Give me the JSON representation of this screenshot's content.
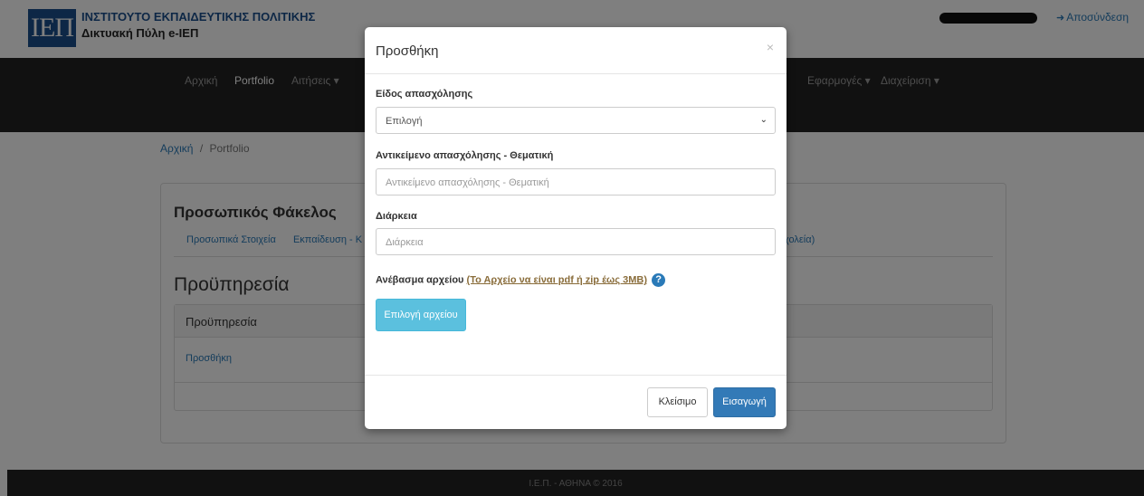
{
  "header": {
    "logo_text": "ΙΕΠ",
    "org_name": "ΙΝΣΤΙΤΟΥΤΟ ΕΚΠΑΙΔΕΥΤΙΚΗΣ ΠΟΛΙΤΙΚΗΣ",
    "portal_name": "Δικτυακή Πύλη e-ΙΕΠ",
    "logout_label": "Αποσύνδεση"
  },
  "nav": {
    "items": [
      "Αρχική",
      "Portfolio",
      "Αιτήσεις ▾",
      "Εφαρμογές ▾",
      "Διαχείριση ▾"
    ]
  },
  "breadcrumb": {
    "home": "Αρχική",
    "separator": "/",
    "current": "Portfolio"
  },
  "panel": {
    "title": "Προσωπικός Φάκελος",
    "tabs": [
      "Προσωπικά Στοιχεία",
      "Εκπαίδευση - Κ"
    ],
    "tab_right": "χολεία)",
    "section_title": "Προϋπηρεσία",
    "table_header": "Προϋπηρεσία",
    "add_link": "Προσθήκη"
  },
  "footer": {
    "text": "Ι.Ε.Π. - ΑΘΗΝΑ © 2016"
  },
  "modal": {
    "title": "Προσθήκη",
    "close_symbol": "×",
    "employment_type_label": "Είδος απασχόλησης",
    "employment_type_value": "Επιλογή",
    "subject_label": "Αντικείμενο απασχόλησης - Θεματική",
    "subject_placeholder": "Αντικείμενο απασχόλησης - Θεματική",
    "duration_label": "Διάρκεια",
    "duration_placeholder": "Διάρκεια",
    "upload_label": "Ανέβασμα αρχείου",
    "upload_hint": "(Το Αρχείο να είναι pdf ή zip έως 3MB)",
    "help_symbol": "?",
    "file_button": "Επιλογή αρχείου",
    "close_button": "Κλείσιμο",
    "submit_button": "Εισαγωγή"
  },
  "colors": {
    "brand_blue": "#1b4f8c",
    "link_blue": "#2a7ab8",
    "navbar_bg": "#222222",
    "info_button": "#5bc0de",
    "primary_button": "#337ab7"
  }
}
